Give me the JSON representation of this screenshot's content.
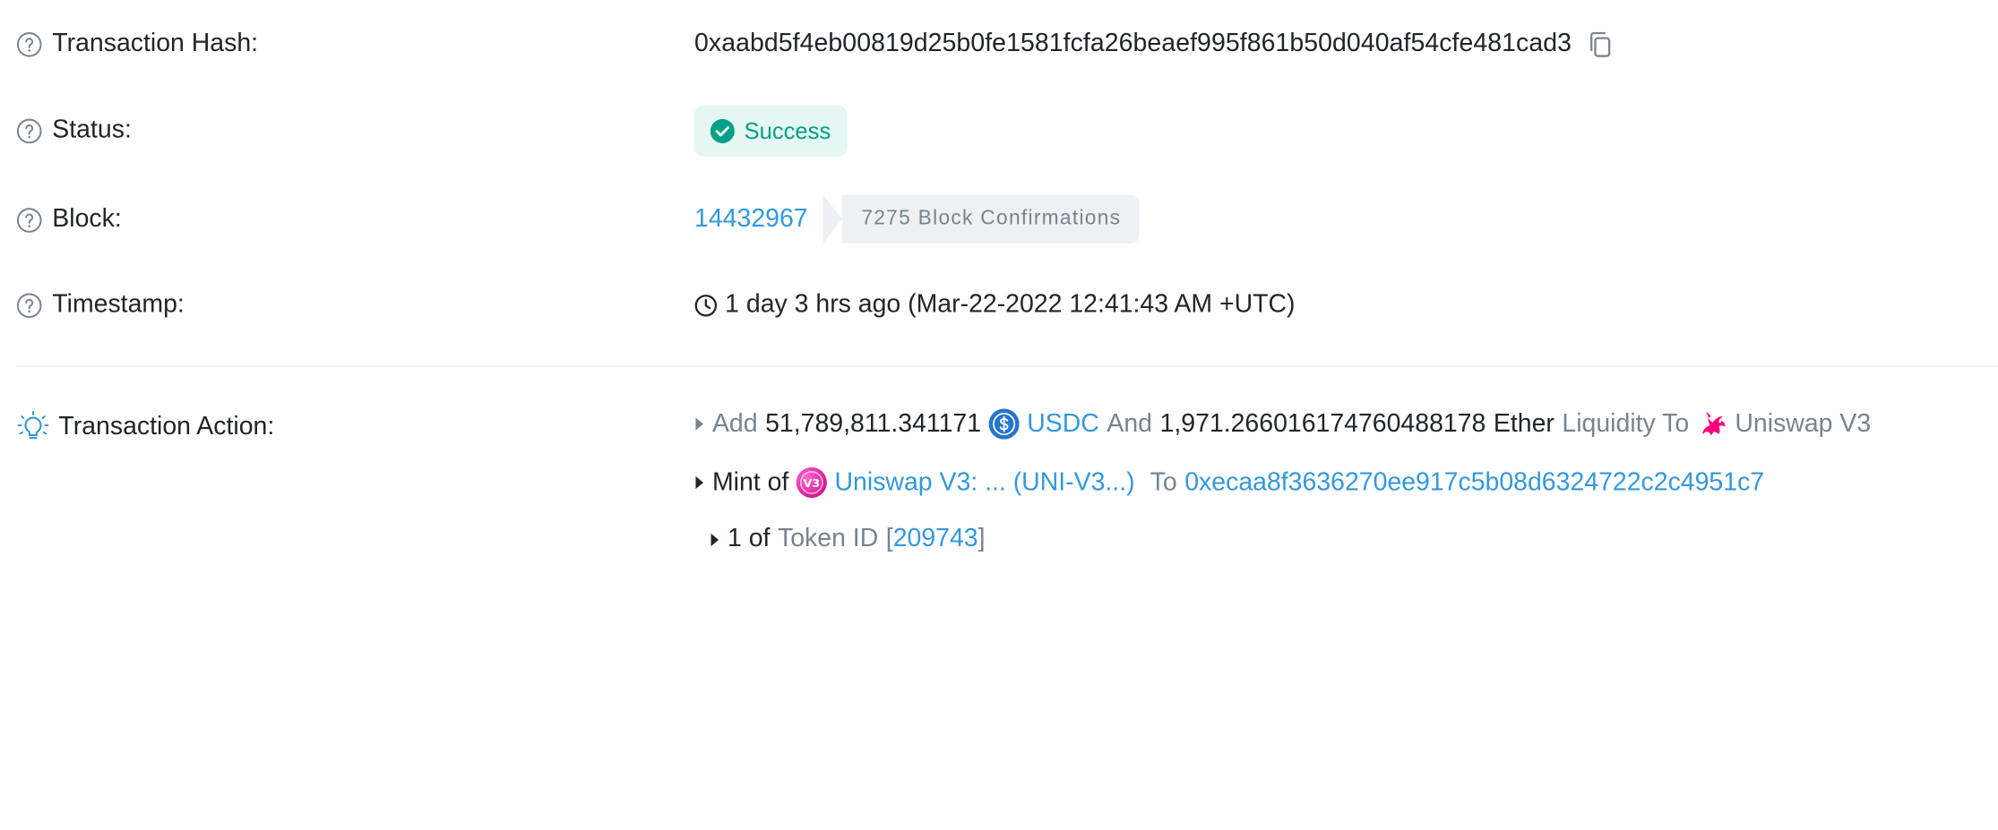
{
  "rows": {
    "hash": {
      "label": "Transaction Hash:",
      "value": "0xaabd5f4eb00819d25b0fe1581fcfa26beaef995f861b50d040af54cfe481cad3"
    },
    "status": {
      "label": "Status:",
      "value": "Success"
    },
    "block": {
      "label": "Block:",
      "number": "14432967",
      "confirmations": "7275 Block Confirmations"
    },
    "timestamp": {
      "label": "Timestamp:",
      "value": "1 day 3 hrs ago (Mar-22-2022 12:41:43 AM +UTC)"
    }
  },
  "action": {
    "label": "Transaction Action:",
    "line1": {
      "add": "Add",
      "amount1": "51,789,811.341171",
      "token1": "USDC",
      "and": "And",
      "amount2": "1,971.266016174760488178",
      "token2": "Ether",
      "liquidity_to": "Liquidity To",
      "protocol": "Uniswap V3"
    },
    "line2": {
      "mint_of": "Mint of",
      "nft": "Uniswap V3: ... (UNI-V3...)",
      "to": "To",
      "address": "0xecaa8f3636270ee917c5b08d6324722c2c4951c7"
    },
    "line3": {
      "count": "1 of",
      "token_id_label": "Token ID",
      "bracket_open": "[",
      "token_id": "209743",
      "bracket_close": "]"
    }
  },
  "colors": {
    "link": "#3498db",
    "success": "#00a186",
    "success_bg": "#e6f7f3",
    "muted": "#77838f",
    "usdc": "#2775ca",
    "uni_nft": "#e94aa3"
  },
  "icons": [
    "question-circle-icon",
    "copy-icon",
    "check-circle-icon",
    "clock-icon",
    "lightbulb-icon",
    "caret-right-icon",
    "usdc-logo-icon",
    "uniswap-unicorn-icon",
    "uniswap-v3-nft-icon"
  ]
}
